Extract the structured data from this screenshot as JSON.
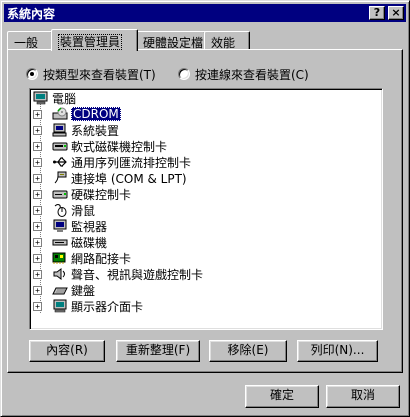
{
  "window": {
    "title": "系統內容",
    "help_glyph": "?",
    "close_glyph": "×"
  },
  "tabs": [
    {
      "label": "一般"
    },
    {
      "label": "裝置管理員"
    },
    {
      "label": "硬體設定檔"
    },
    {
      "label": "效能"
    }
  ],
  "view_options": {
    "by_type": "按類型來查看裝置(T)",
    "by_connection": "按連線來查看裝置(C)",
    "selected": "by_type"
  },
  "tree": {
    "root": "電腦",
    "items": [
      {
        "label": "CDROM",
        "icon": "cdrom-icon",
        "selected": true
      },
      {
        "label": "系統裝置",
        "icon": "system-device-icon"
      },
      {
        "label": "軟式磁碟機控制卡",
        "icon": "floppy-controller-icon"
      },
      {
        "label": "通用序列匯流排控制卡",
        "icon": "usb-icon"
      },
      {
        "label": "連接埠 (COM & LPT)",
        "icon": "port-icon"
      },
      {
        "label": "硬碟控制卡",
        "icon": "hdd-controller-icon"
      },
      {
        "label": "滑鼠",
        "icon": "mouse-icon"
      },
      {
        "label": "監視器",
        "icon": "monitor-icon"
      },
      {
        "label": "磁碟機",
        "icon": "disk-drive-icon"
      },
      {
        "label": "網路配接卡",
        "icon": "network-adapter-icon"
      },
      {
        "label": "聲音、視訊與遊戲控制卡",
        "icon": "sound-icon"
      },
      {
        "label": "鍵盤",
        "icon": "keyboard-icon"
      },
      {
        "label": "顯示器介面卡",
        "icon": "display-adapter-icon"
      }
    ]
  },
  "actions": {
    "properties": "內容(R)",
    "refresh": "重新整理(F)",
    "remove": "移除(E)",
    "print": "列印(N)..."
  },
  "dialog": {
    "ok": "確定",
    "cancel": "取消"
  }
}
